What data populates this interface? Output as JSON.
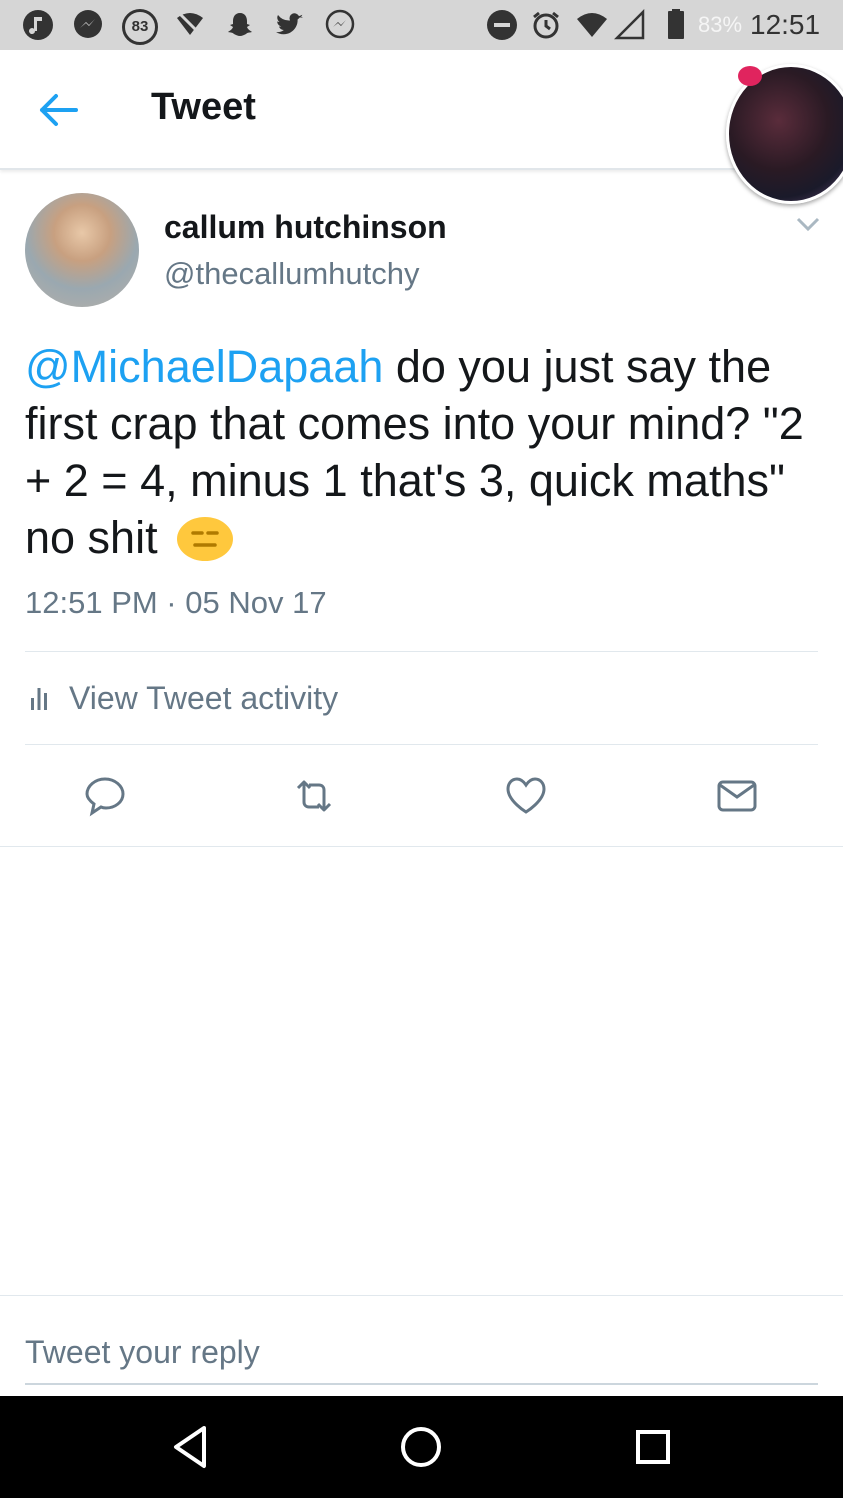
{
  "status_bar": {
    "notification_count": "83",
    "battery": "83%",
    "time": "12:51",
    "icons": [
      "music-icon",
      "messenger-icon",
      "badge-83",
      "wifi-off-icon",
      "snapchat-icon",
      "twitter-icon",
      "messenger-outline-icon",
      "dnd-icon",
      "alarm-icon",
      "wifi-icon",
      "signal-icon",
      "battery-icon"
    ]
  },
  "header": {
    "title": "Tweet",
    "back_icon": "arrow-left-icon"
  },
  "tweet": {
    "display_name": "callum hutchinson",
    "handle": "@thecallumhutchy",
    "mention": "@MichaelDapaah",
    "body": " do you just say the first crap that comes into your mind? \"2 + 2 = 4, minus 1 that's 3, quick maths\" no shit ",
    "emoji": "expressionless-face-emoji",
    "timestamp": "12:51 PM · 05 Nov 17"
  },
  "activity": {
    "label": "View Tweet activity",
    "icon": "bar-chart-icon"
  },
  "actions": [
    "reply-icon",
    "retweet-icon",
    "like-icon",
    "direct-message-icon"
  ],
  "reply": {
    "placeholder": "Tweet your reply"
  },
  "nav": [
    "back-triangle-icon",
    "home-circle-icon",
    "recents-square-icon"
  ],
  "colors": {
    "accent": "#1da1f2",
    "text": "#14171a",
    "secondary": "#657786",
    "emoji": "#ffc83d"
  }
}
